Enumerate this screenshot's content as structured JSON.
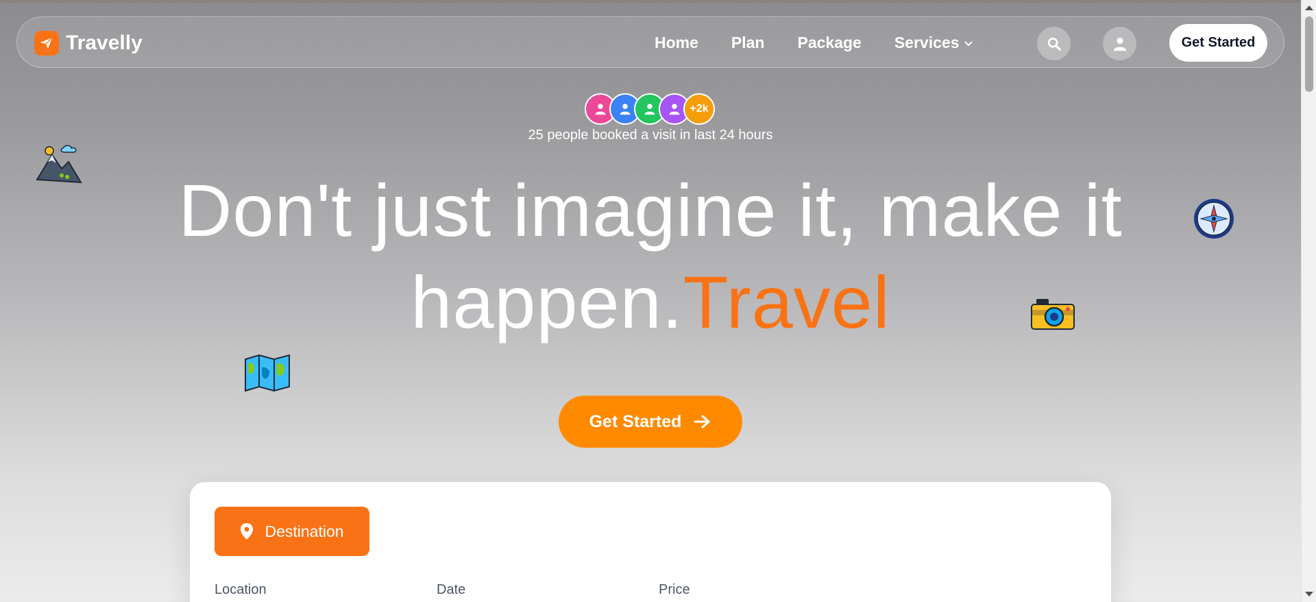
{
  "brand": {
    "name": "Travelly"
  },
  "nav": {
    "items": [
      "Home",
      "Plan",
      "Package"
    ],
    "services_label": "Services",
    "cta_label": "Get Started"
  },
  "icons": {
    "search": "search-icon",
    "user": "user-icon",
    "chevron": "chevron-down-icon",
    "send": "paper-plane-icon"
  },
  "social_proof": {
    "more_label": "+2k",
    "text": "25 people booked a visit in last 24 hours",
    "avatar_colors": [
      "#ec4899",
      "#3b82f6",
      "#22c55e",
      "#a855f7",
      "#f59e0b"
    ]
  },
  "hero": {
    "line1": "Don't just imagine it, make it",
    "line2": "happen.",
    "accent": "Travel",
    "cta_label": "Get Started"
  },
  "booking": {
    "tab_label": "Destination",
    "fields": [
      "Location",
      "Date",
      "Price"
    ]
  },
  "colors": {
    "accent": "#f97316",
    "cta": "#ff8a00"
  }
}
